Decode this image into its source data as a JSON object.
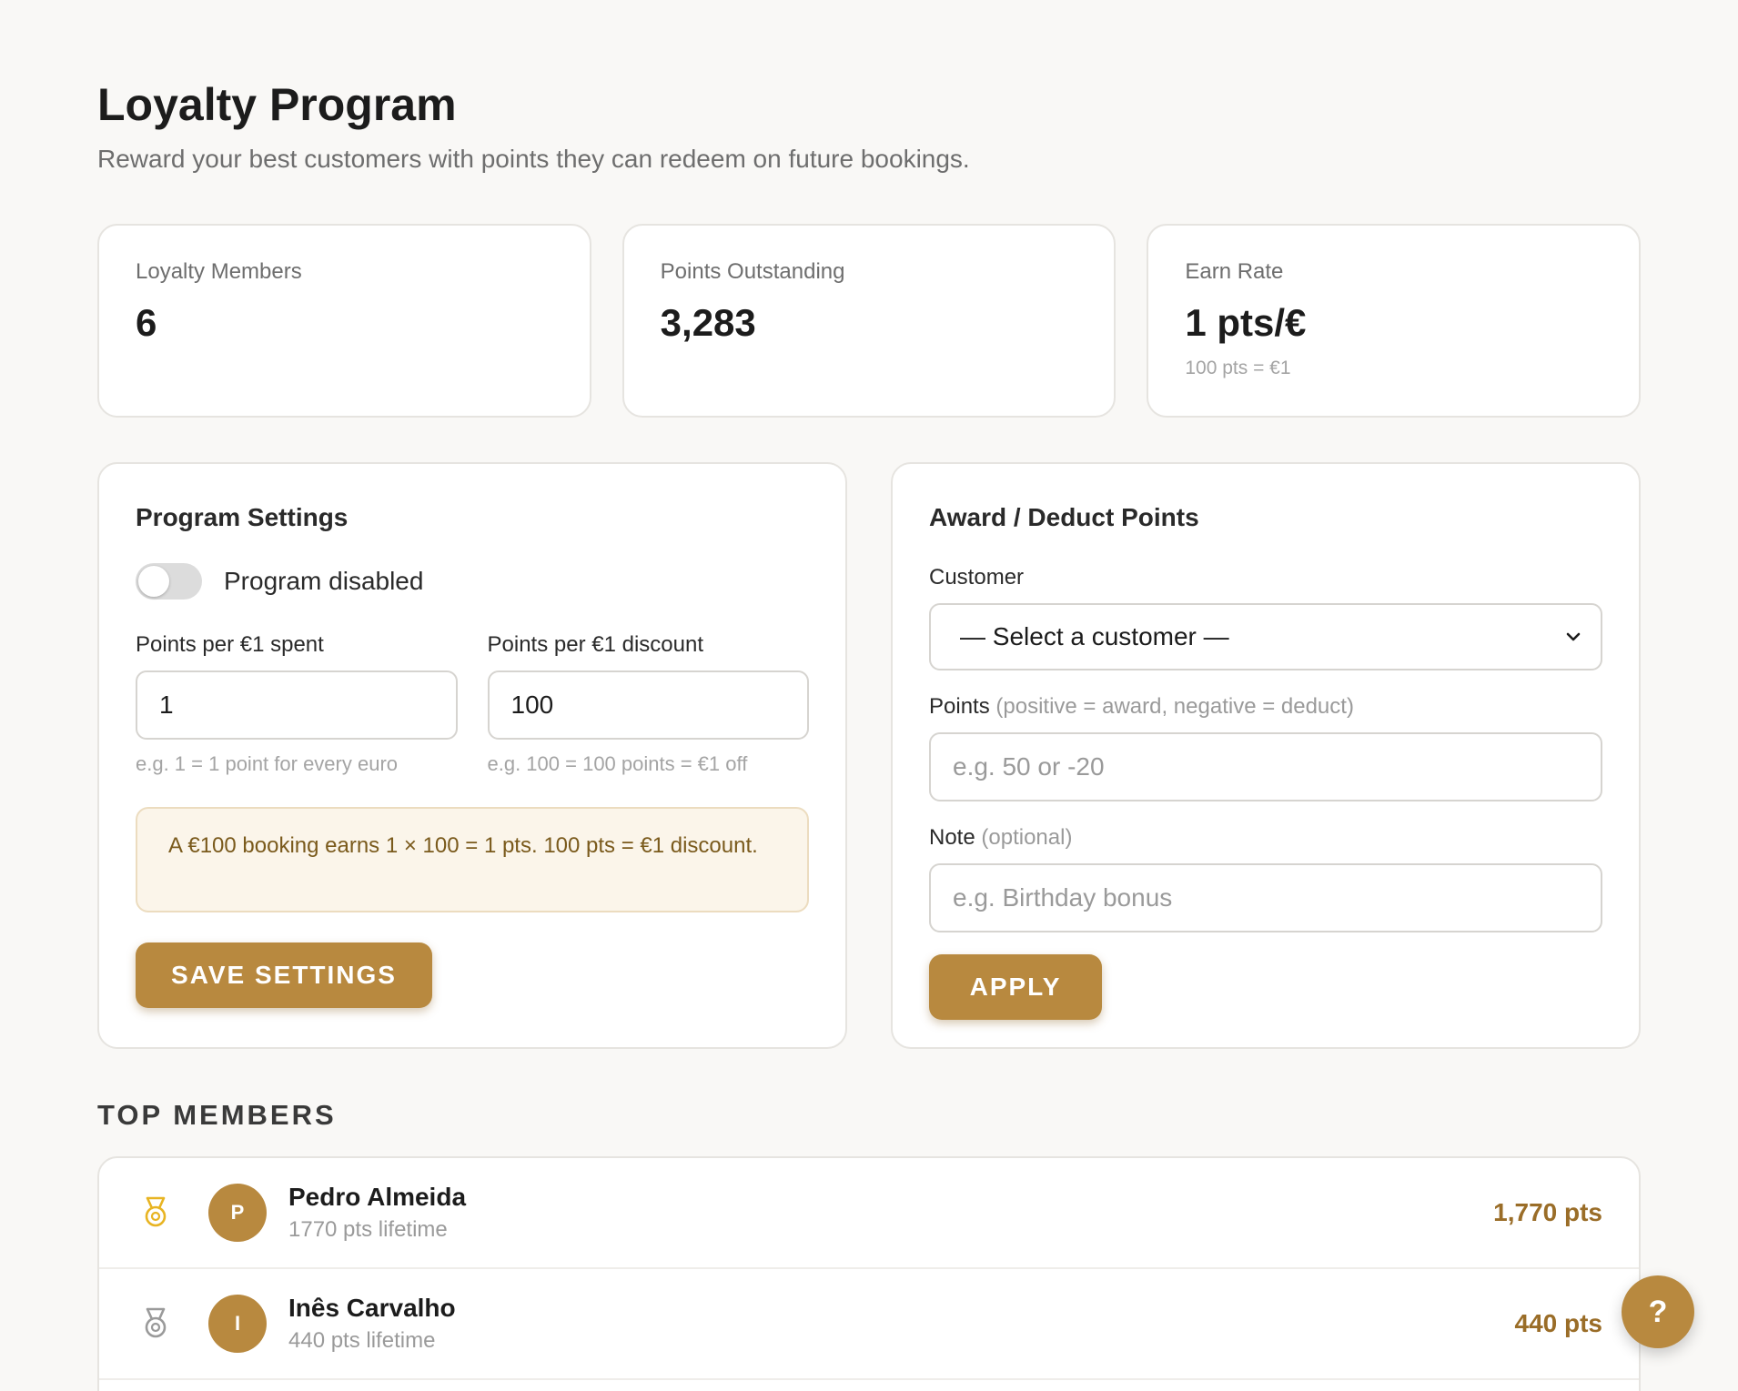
{
  "header": {
    "title": "Loyalty Program",
    "subtitle": "Reward your best customers with points they can redeem on future bookings."
  },
  "stats": [
    {
      "label": "Loyalty Members",
      "value": "6",
      "sub": ""
    },
    {
      "label": "Points Outstanding",
      "value": "3,283",
      "sub": ""
    },
    {
      "label": "Earn Rate",
      "value": "1 pts/€",
      "sub": "100 pts = €1"
    }
  ],
  "settings": {
    "title": "Program Settings",
    "toggle_label": "Program disabled",
    "toggle_on": false,
    "earn_label": "Points per €1 spent",
    "earn_value": "1",
    "earn_hint": "e.g. 1 = 1 point for every euro",
    "redeem_label": "Points per €1 discount",
    "redeem_value": "100",
    "redeem_hint": "e.g. 100 = 100 points = €1 off",
    "info": "A €100 booking earns 1 × 100 = 1 pts. 100 pts = €1 discount.",
    "save_label": "Save Settings"
  },
  "award": {
    "title": "Award / Deduct Points",
    "customer_label": "Customer",
    "customer_selected": "— Select a customer —",
    "points_label": "Points",
    "points_label_muted": "(positive = award, negative = deduct)",
    "points_placeholder": "e.g. 50 or -20",
    "note_label": "Note",
    "note_label_muted": "(optional)",
    "note_placeholder": "e.g. Birthday bonus",
    "apply_label": "Apply"
  },
  "members": {
    "title": "TOP MEMBERS",
    "items": [
      {
        "initial": "P",
        "name": "Pedro Almeida",
        "lifetime": "1770 pts lifetime",
        "points": "1,770 pts",
        "medal": "gold-medal-icon",
        "medal_color": "#e8b422"
      },
      {
        "initial": "I",
        "name": "Inês Carvalho",
        "lifetime": "440 pts lifetime",
        "points": "440 pts",
        "medal": "silver-medal-icon",
        "medal_color": "#9a9a9a"
      }
    ]
  },
  "help": {
    "label": "?"
  },
  "colors": {
    "accent": "#b8893f",
    "accent_text": "#9a6d28",
    "info_bg": "#fbf5ea"
  }
}
